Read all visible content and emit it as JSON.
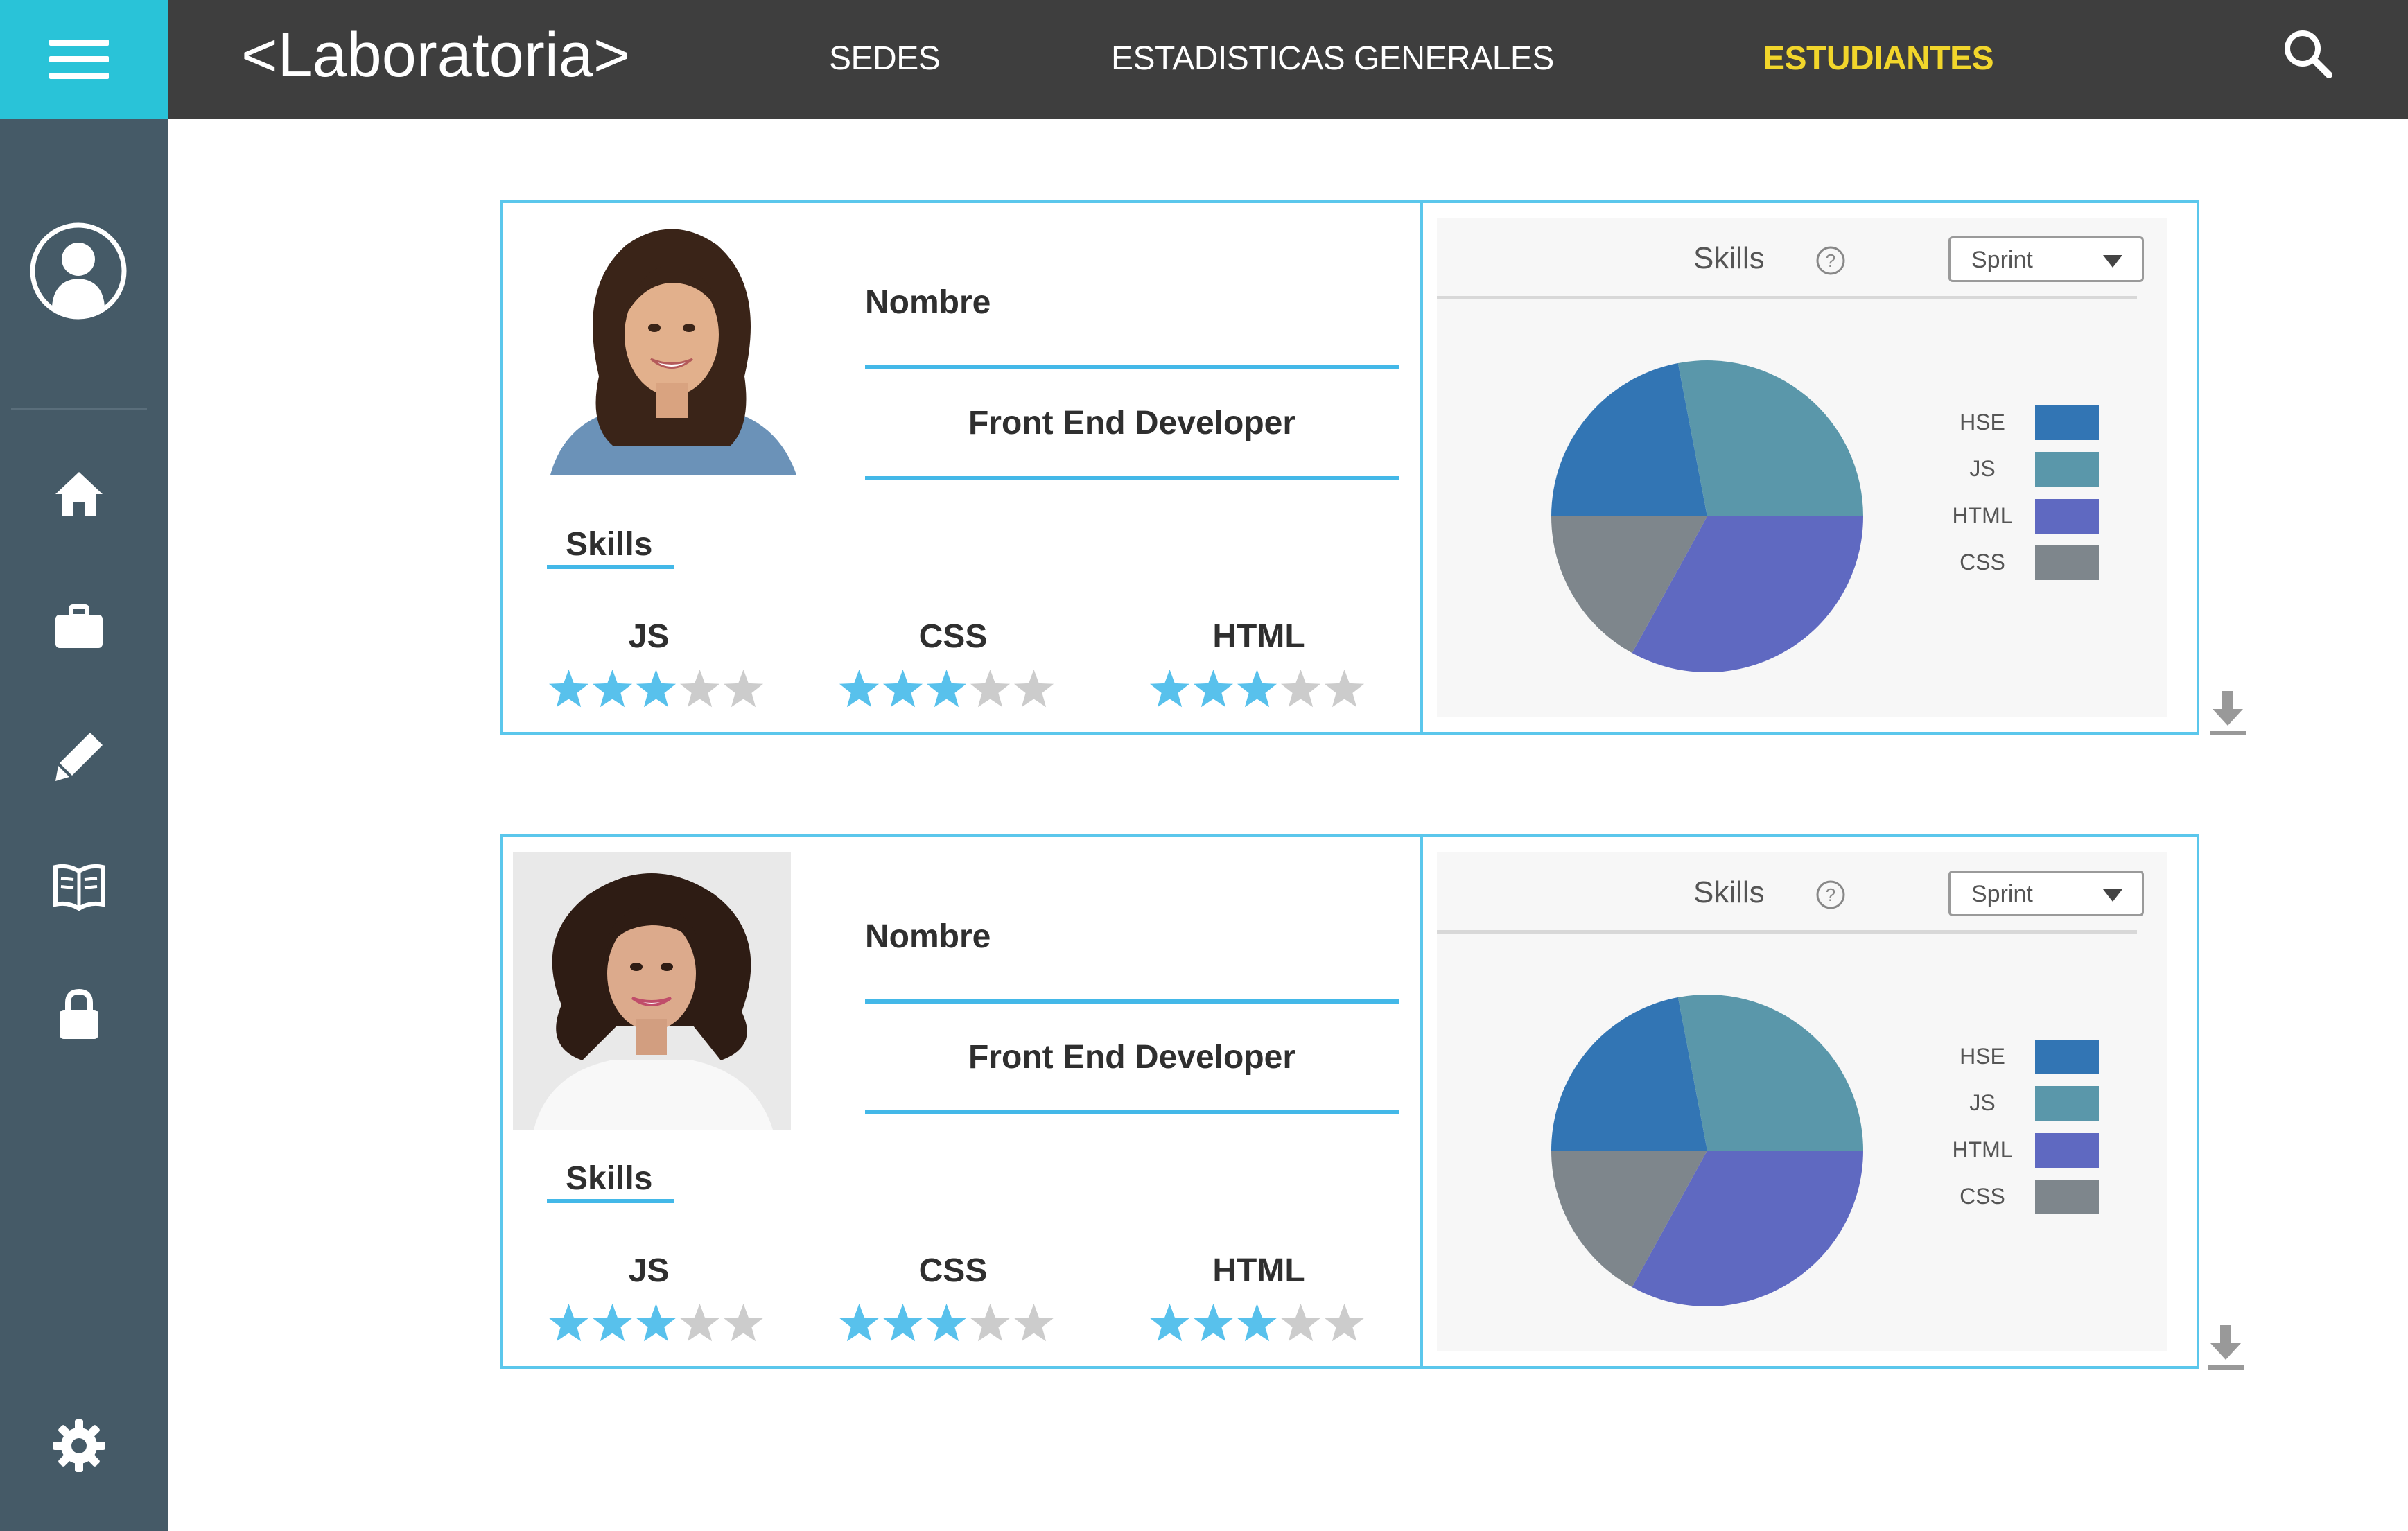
{
  "app": {
    "brand": "<Laboratoria>"
  },
  "nav": [
    {
      "label": "SEDES",
      "active": false
    },
    {
      "label": "ESTADISTICAS GENERALES",
      "active": false
    },
    {
      "label": "ESTUDIANTES",
      "active": true
    }
  ],
  "colors": {
    "topbar": "#3e3e3e",
    "accent": "#29c3d8",
    "sidebar": "#455a67",
    "card_border": "#5bc7ec",
    "star_on": "#58c1ec",
    "star_off": "#cccccc",
    "nav_active": "#f2d62b"
  },
  "sidebar": {
    "icons": [
      "user-avatar-icon",
      "home-icon",
      "briefcase-icon",
      "pencil-icon",
      "book-icon",
      "lock-icon",
      "gear-icon"
    ]
  },
  "students": [
    {
      "name_label": "Nombre",
      "role": "Front End Developer",
      "skills_title": "Skills",
      "skills": [
        {
          "name": "JS",
          "rating": 3,
          "max": 5
        },
        {
          "name": "CSS",
          "rating": 3,
          "max": 5
        },
        {
          "name": "HTML",
          "rating": 3,
          "max": 5
        }
      ],
      "chart_title": "Skills",
      "select_value": "Sprint"
    },
    {
      "name_label": "Nombre",
      "role": "Front End Developer",
      "skills_title": "Skills",
      "skills": [
        {
          "name": "JS",
          "rating": 3,
          "max": 5
        },
        {
          "name": "CSS",
          "rating": 3,
          "max": 5
        },
        {
          "name": "HTML",
          "rating": 3,
          "max": 5
        }
      ],
      "chart_title": "Skills",
      "select_value": "Sprint"
    }
  ],
  "chart_data": [
    {
      "type": "pie",
      "labels": [
        "HSE",
        "JS",
        "HTML",
        "CSS"
      ],
      "values": [
        22,
        28,
        33,
        17
      ],
      "colors": [
        "#3275b4",
        "#5a97aa",
        "#5f69c1",
        "#7e868c"
      ],
      "legend_position": "right"
    },
    {
      "type": "pie",
      "labels": [
        "HSE",
        "JS",
        "HTML",
        "CSS"
      ],
      "values": [
        22,
        28,
        33,
        17
      ],
      "colors": [
        "#3275b4",
        "#5a97aa",
        "#5f69c1",
        "#7e868c"
      ],
      "legend_position": "right"
    }
  ]
}
